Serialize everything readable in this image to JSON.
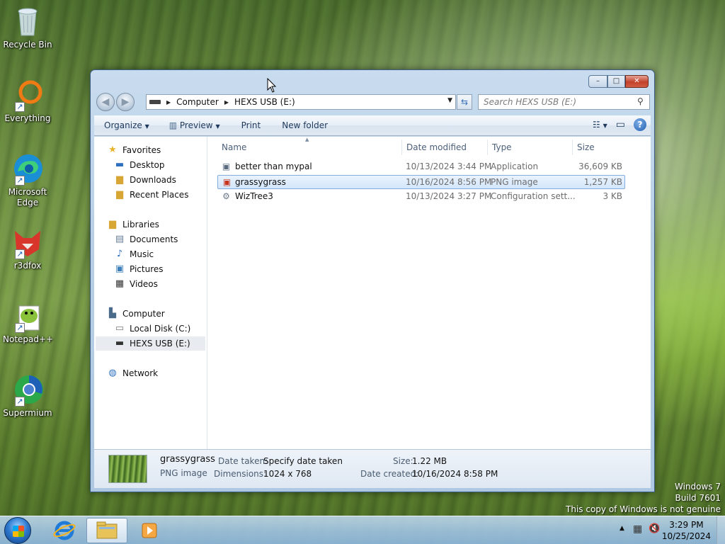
{
  "desktop": {
    "icons": [
      {
        "label": "Recycle Bin",
        "icon": "recycle-bin-icon"
      },
      {
        "label": "Everything",
        "icon": "everything-search-icon"
      },
      {
        "label": "Microsoft Edge",
        "icon": "edge-icon"
      },
      {
        "label": "r3dfox",
        "icon": "r3dfox-icon"
      },
      {
        "label": "Notepad++",
        "icon": "notepad-plus-plus-icon"
      },
      {
        "label": "Supermium",
        "icon": "supermium-icon"
      }
    ],
    "watermark": {
      "line1": "Windows 7",
      "line2": "Build 7601",
      "line3": "This copy of Windows is not genuine"
    }
  },
  "explorer": {
    "window_controls": {
      "minimize": "–",
      "maximize": "□",
      "close": "✕"
    },
    "address": {
      "crumbs": [
        "Computer",
        "HEXS USB (E:)"
      ]
    },
    "search": {
      "placeholder": "Search HEXS USB (E:)"
    },
    "toolbar": {
      "organize": "Organize",
      "preview": "Preview",
      "print": "Print",
      "new_folder": "New folder"
    },
    "nav": {
      "favorites": "Favorites",
      "desktop": "Desktop",
      "downloads": "Downloads",
      "recent": "Recent Places",
      "libraries": "Libraries",
      "documents": "Documents",
      "music": "Music",
      "pictures": "Pictures",
      "videos": "Videos",
      "computer": "Computer",
      "local_disk": "Local Disk (C:)",
      "usb": "HEXS USB (E:)",
      "network": "Network"
    },
    "columns": {
      "name": "Name",
      "date": "Date modified",
      "type": "Type",
      "size": "Size"
    },
    "files": [
      {
        "name": "better than mypal",
        "date": "10/13/2024 3:44 PM",
        "type": "Application",
        "size": "36,609 KB",
        "icon": "application-icon"
      },
      {
        "name": "grassygrass",
        "date": "10/16/2024 8:56 PM",
        "type": "PNG image",
        "size": "1,257 KB",
        "icon": "png-image-icon"
      },
      {
        "name": "WizTree3",
        "date": "10/13/2024 3:27 PM",
        "type": "Configuration sett...",
        "size": "3 KB",
        "icon": "config-file-icon"
      }
    ],
    "details": {
      "name": "grassygrass",
      "type": "PNG image",
      "date_taken_label": "Date taken:",
      "date_taken_value": "Specify date taken",
      "dimensions_label": "Dimensions:",
      "dimensions_value": "1024 x 768",
      "size_label": "Size:",
      "size_value": "1.22 MB",
      "date_created_label": "Date created:",
      "date_created_value": "10/16/2024 8:58 PM"
    }
  },
  "taskbar": {
    "time": "3:29 PM",
    "date": "10/25/2024",
    "pinned": [
      "internet-explorer-icon",
      "file-explorer-icon",
      "media-player-icon"
    ]
  }
}
